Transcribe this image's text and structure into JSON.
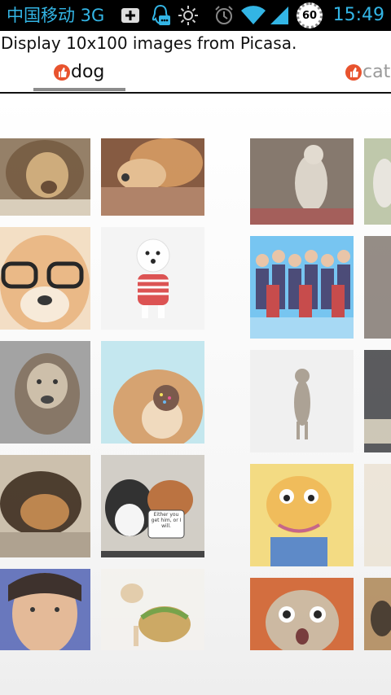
{
  "status_bar": {
    "carrier": "中国移动 3G",
    "battery": "60",
    "time": "15:49"
  },
  "app": {
    "description": "Display 10x100 images from Picasa."
  },
  "tabs": [
    {
      "label": "dog",
      "selected": true
    },
    {
      "label": "cat",
      "selected": false
    }
  ],
  "colors": {
    "status_accent": "#33b5e5",
    "tab_icon": "#e8532e",
    "tab_selected_text": "#111111",
    "tab_unselected_text": "#9a9a9a"
  },
  "dog_grid": [
    {
      "kind": "lion"
    },
    {
      "kind": "pomeranian"
    },
    {
      "kind": "glasses-dog"
    },
    {
      "kind": "white-terrier"
    },
    {
      "kind": "wet-retriever"
    },
    {
      "kind": "sprinkle-nose-dog"
    },
    {
      "kind": "shepherd"
    },
    {
      "kind": "cat-and-dog-meme",
      "caption": "Either you get him, or I will."
    },
    {
      "kind": "person-selfie"
    },
    {
      "kind": "chihuahua-taco"
    }
  ],
  "cat_grid": [
    {
      "kind": "standing-cat"
    },
    {
      "kind": "anime-crowd"
    },
    {
      "kind": "3d-tabby-cat"
    },
    {
      "kind": "cartoon-cat"
    },
    {
      "kind": "surprised-cat"
    }
  ]
}
